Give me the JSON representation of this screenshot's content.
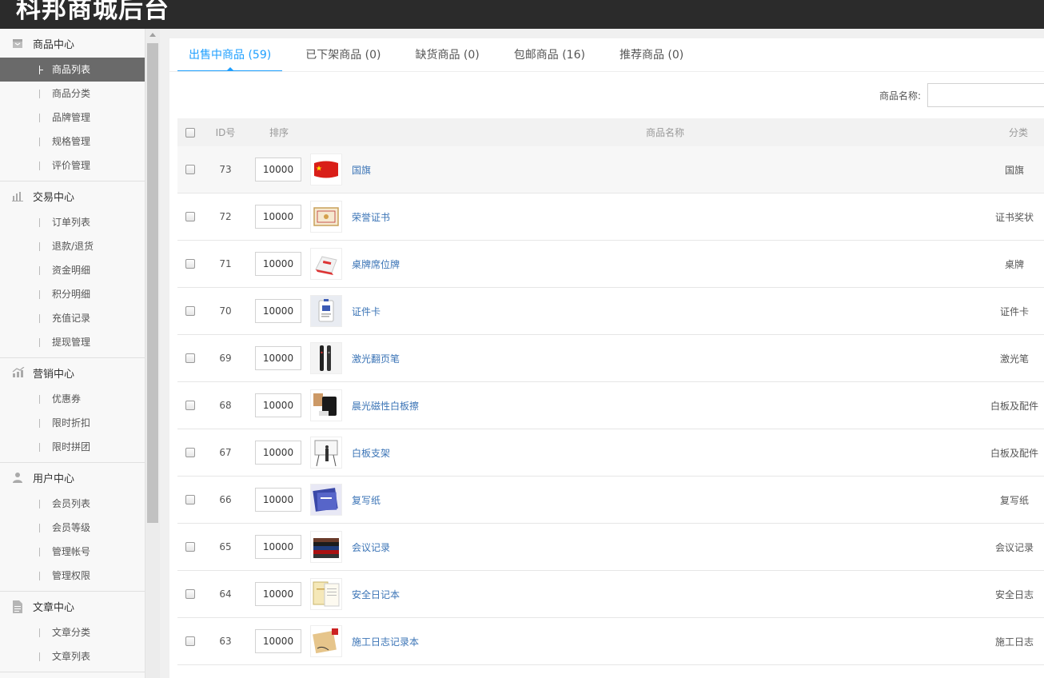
{
  "header": {
    "title": "科邦商城后台"
  },
  "sidebar": {
    "groups": [
      {
        "title": "商品中心",
        "icon": "package-icon",
        "items": [
          "商品列表",
          "商品分类",
          "品牌管理",
          "规格管理",
          "评价管理"
        ],
        "active": 0
      },
      {
        "title": "交易中心",
        "icon": "bar-chart-icon",
        "items": [
          "订单列表",
          "退款/退货",
          "资金明细",
          "积分明细",
          "充值记录",
          "提现管理"
        ],
        "active": -1
      },
      {
        "title": "营销中心",
        "icon": "marketing-chart-icon",
        "items": [
          "优惠券",
          "限时折扣",
          "限时拼团"
        ],
        "active": -1
      },
      {
        "title": "用户中心",
        "icon": "user-icon",
        "items": [
          "会员列表",
          "会员等级",
          "管理帐号",
          "管理权限"
        ],
        "active": -1
      },
      {
        "title": "文章中心",
        "icon": "document-icon",
        "items": [
          "文章分类",
          "文章列表"
        ],
        "active": -1
      }
    ]
  },
  "tabs": [
    {
      "label": "出售中商品 (59)",
      "active": true
    },
    {
      "label": "已下架商品 (0)",
      "active": false
    },
    {
      "label": "缺货商品 (0)",
      "active": false
    },
    {
      "label": "包邮商品 (16)",
      "active": false
    },
    {
      "label": "推荐商品 (0)",
      "active": false
    }
  ],
  "search": {
    "label": "商品名称:",
    "placeholder": ""
  },
  "table": {
    "headers": {
      "id": "ID号",
      "sort": "排序",
      "name": "商品名称",
      "category": "分类"
    },
    "rows": [
      {
        "id": "73",
        "sort": "10000",
        "name": "国旗",
        "category": "国旗",
        "thumb": "flag"
      },
      {
        "id": "72",
        "sort": "10000",
        "name": "荣誉证书",
        "category": "证书奖状",
        "thumb": "certificate"
      },
      {
        "id": "71",
        "sort": "10000",
        "name": "桌牌席位牌",
        "category": "桌牌",
        "thumb": "tablecard"
      },
      {
        "id": "70",
        "sort": "10000",
        "name": "证件卡",
        "category": "证件卡",
        "thumb": "idcard"
      },
      {
        "id": "69",
        "sort": "10000",
        "name": "激光翻页笔",
        "category": "激光笔",
        "thumb": "pen"
      },
      {
        "id": "68",
        "sort": "10000",
        "name": "晨光磁性白板擦",
        "category": "白板及配件",
        "thumb": "eraser"
      },
      {
        "id": "67",
        "sort": "10000",
        "name": "白板支架",
        "category": "白板及配件",
        "thumb": "whiteboard"
      },
      {
        "id": "66",
        "sort": "10000",
        "name": "复写纸",
        "category": "复写纸",
        "thumb": "carbon"
      },
      {
        "id": "65",
        "sort": "10000",
        "name": "会议记录",
        "category": "会议记录",
        "thumb": "notebooks"
      },
      {
        "id": "64",
        "sort": "10000",
        "name": "安全日记本",
        "category": "安全日志",
        "thumb": "diary"
      },
      {
        "id": "63",
        "sort": "10000",
        "name": "施工日志记录本",
        "category": "施工日志",
        "thumb": "log"
      }
    ]
  },
  "colors": {
    "accent": "#1e9fff",
    "link": "#3b74b6",
    "topbar": "#2b2b2b",
    "active_item": "#6a6a6a"
  }
}
